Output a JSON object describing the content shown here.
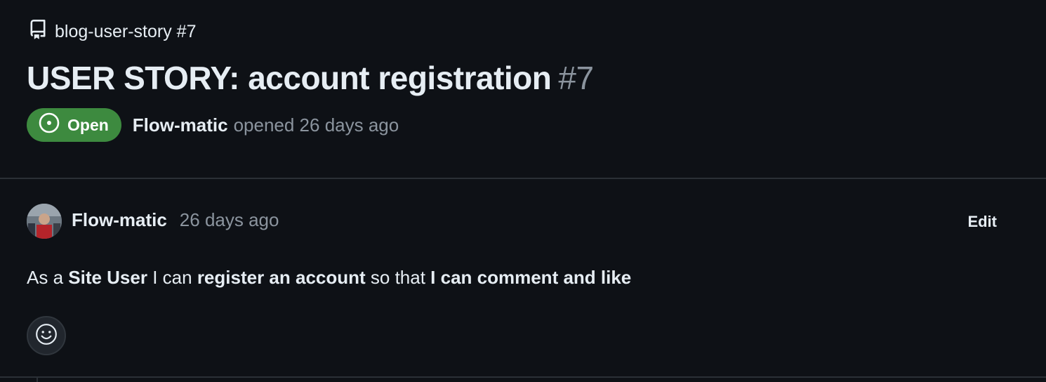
{
  "repo": {
    "label": "blog-user-story #7",
    "icon": "repo-icon"
  },
  "issue": {
    "title": "USER STORY: account registration",
    "number": "#7",
    "state": {
      "label": "Open",
      "icon": "issue-opened-icon",
      "color": "#3d8a3f"
    },
    "author": "Flow-matic",
    "opened_text": "opened 26 days ago"
  },
  "comment": {
    "author": "Flow-matic",
    "time": "26 days ago",
    "edit_label": "Edit",
    "body": {
      "part1": "As a ",
      "bold1": "Site User",
      "part2": " I can ",
      "bold2": "register an account",
      "part3": " so that ",
      "bold3": "I can comment and like"
    },
    "reaction_icon": "smiley-icon"
  },
  "colors": {
    "background": "#0e1116",
    "muted": "#8b949e",
    "text": "#e6edf3",
    "open_green": "#3d8a3f"
  }
}
